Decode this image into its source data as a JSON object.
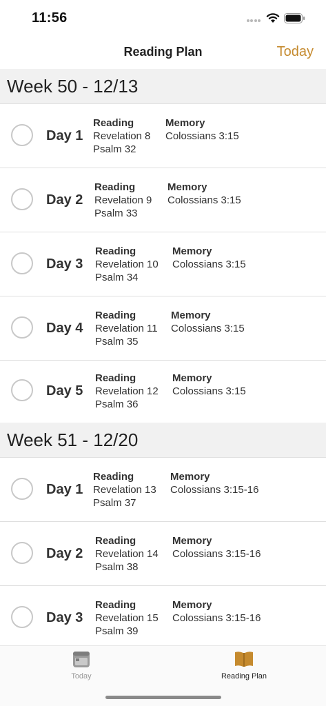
{
  "status": {
    "time": "11:56"
  },
  "nav": {
    "title": "Reading Plan",
    "today_label": "Today"
  },
  "colors": {
    "accent": "#c58a2e",
    "week_bg": "#f1f1f1",
    "circle": "#c8c8c8"
  },
  "weeks": [
    {
      "title": "Week 50 - 12/13",
      "days": [
        {
          "label": "Day 1",
          "reading_header": "Reading",
          "reading": [
            "Revelation 8",
            "Psalm 32"
          ],
          "memory_header": "Memory",
          "memory": "Colossians 3:15",
          "completed": false
        },
        {
          "label": "Day 2",
          "reading_header": "Reading",
          "reading": [
            "Revelation 9",
            "Psalm 33"
          ],
          "memory_header": "Memory",
          "memory": "Colossians 3:15",
          "completed": false
        },
        {
          "label": "Day 3",
          "reading_header": "Reading",
          "reading": [
            "Revelation 10",
            "Psalm 34"
          ],
          "memory_header": "Memory",
          "memory": "Colossians 3:15",
          "completed": false
        },
        {
          "label": "Day 4",
          "reading_header": "Reading",
          "reading": [
            "Revelation 11",
            "Psalm 35"
          ],
          "memory_header": "Memory",
          "memory": "Colossians 3:15",
          "completed": false
        },
        {
          "label": "Day 5",
          "reading_header": "Reading",
          "reading": [
            "Revelation 12",
            "Psalm 36"
          ],
          "memory_header": "Memory",
          "memory": "Colossians 3:15",
          "completed": false
        }
      ]
    },
    {
      "title": "Week 51 - 12/20",
      "days": [
        {
          "label": "Day 1",
          "reading_header": "Reading",
          "reading": [
            "Revelation 13",
            "Psalm 37"
          ],
          "memory_header": "Memory",
          "memory": "Colossians 3:15-16",
          "completed": false
        },
        {
          "label": "Day 2",
          "reading_header": "Reading",
          "reading": [
            "Revelation 14",
            "Psalm 38"
          ],
          "memory_header": "Memory",
          "memory": "Colossians 3:15-16",
          "completed": false
        },
        {
          "label": "Day 3",
          "reading_header": "Reading",
          "reading": [
            "Revelation 15",
            "Psalm 39"
          ],
          "memory_header": "Memory",
          "memory": "Colossians 3:15-16",
          "completed": false
        }
      ]
    }
  ],
  "tabs": [
    {
      "label": "Today",
      "icon": "calendar-icon",
      "selected": false
    },
    {
      "label": "Reading Plan",
      "icon": "book-icon",
      "selected": true
    }
  ]
}
